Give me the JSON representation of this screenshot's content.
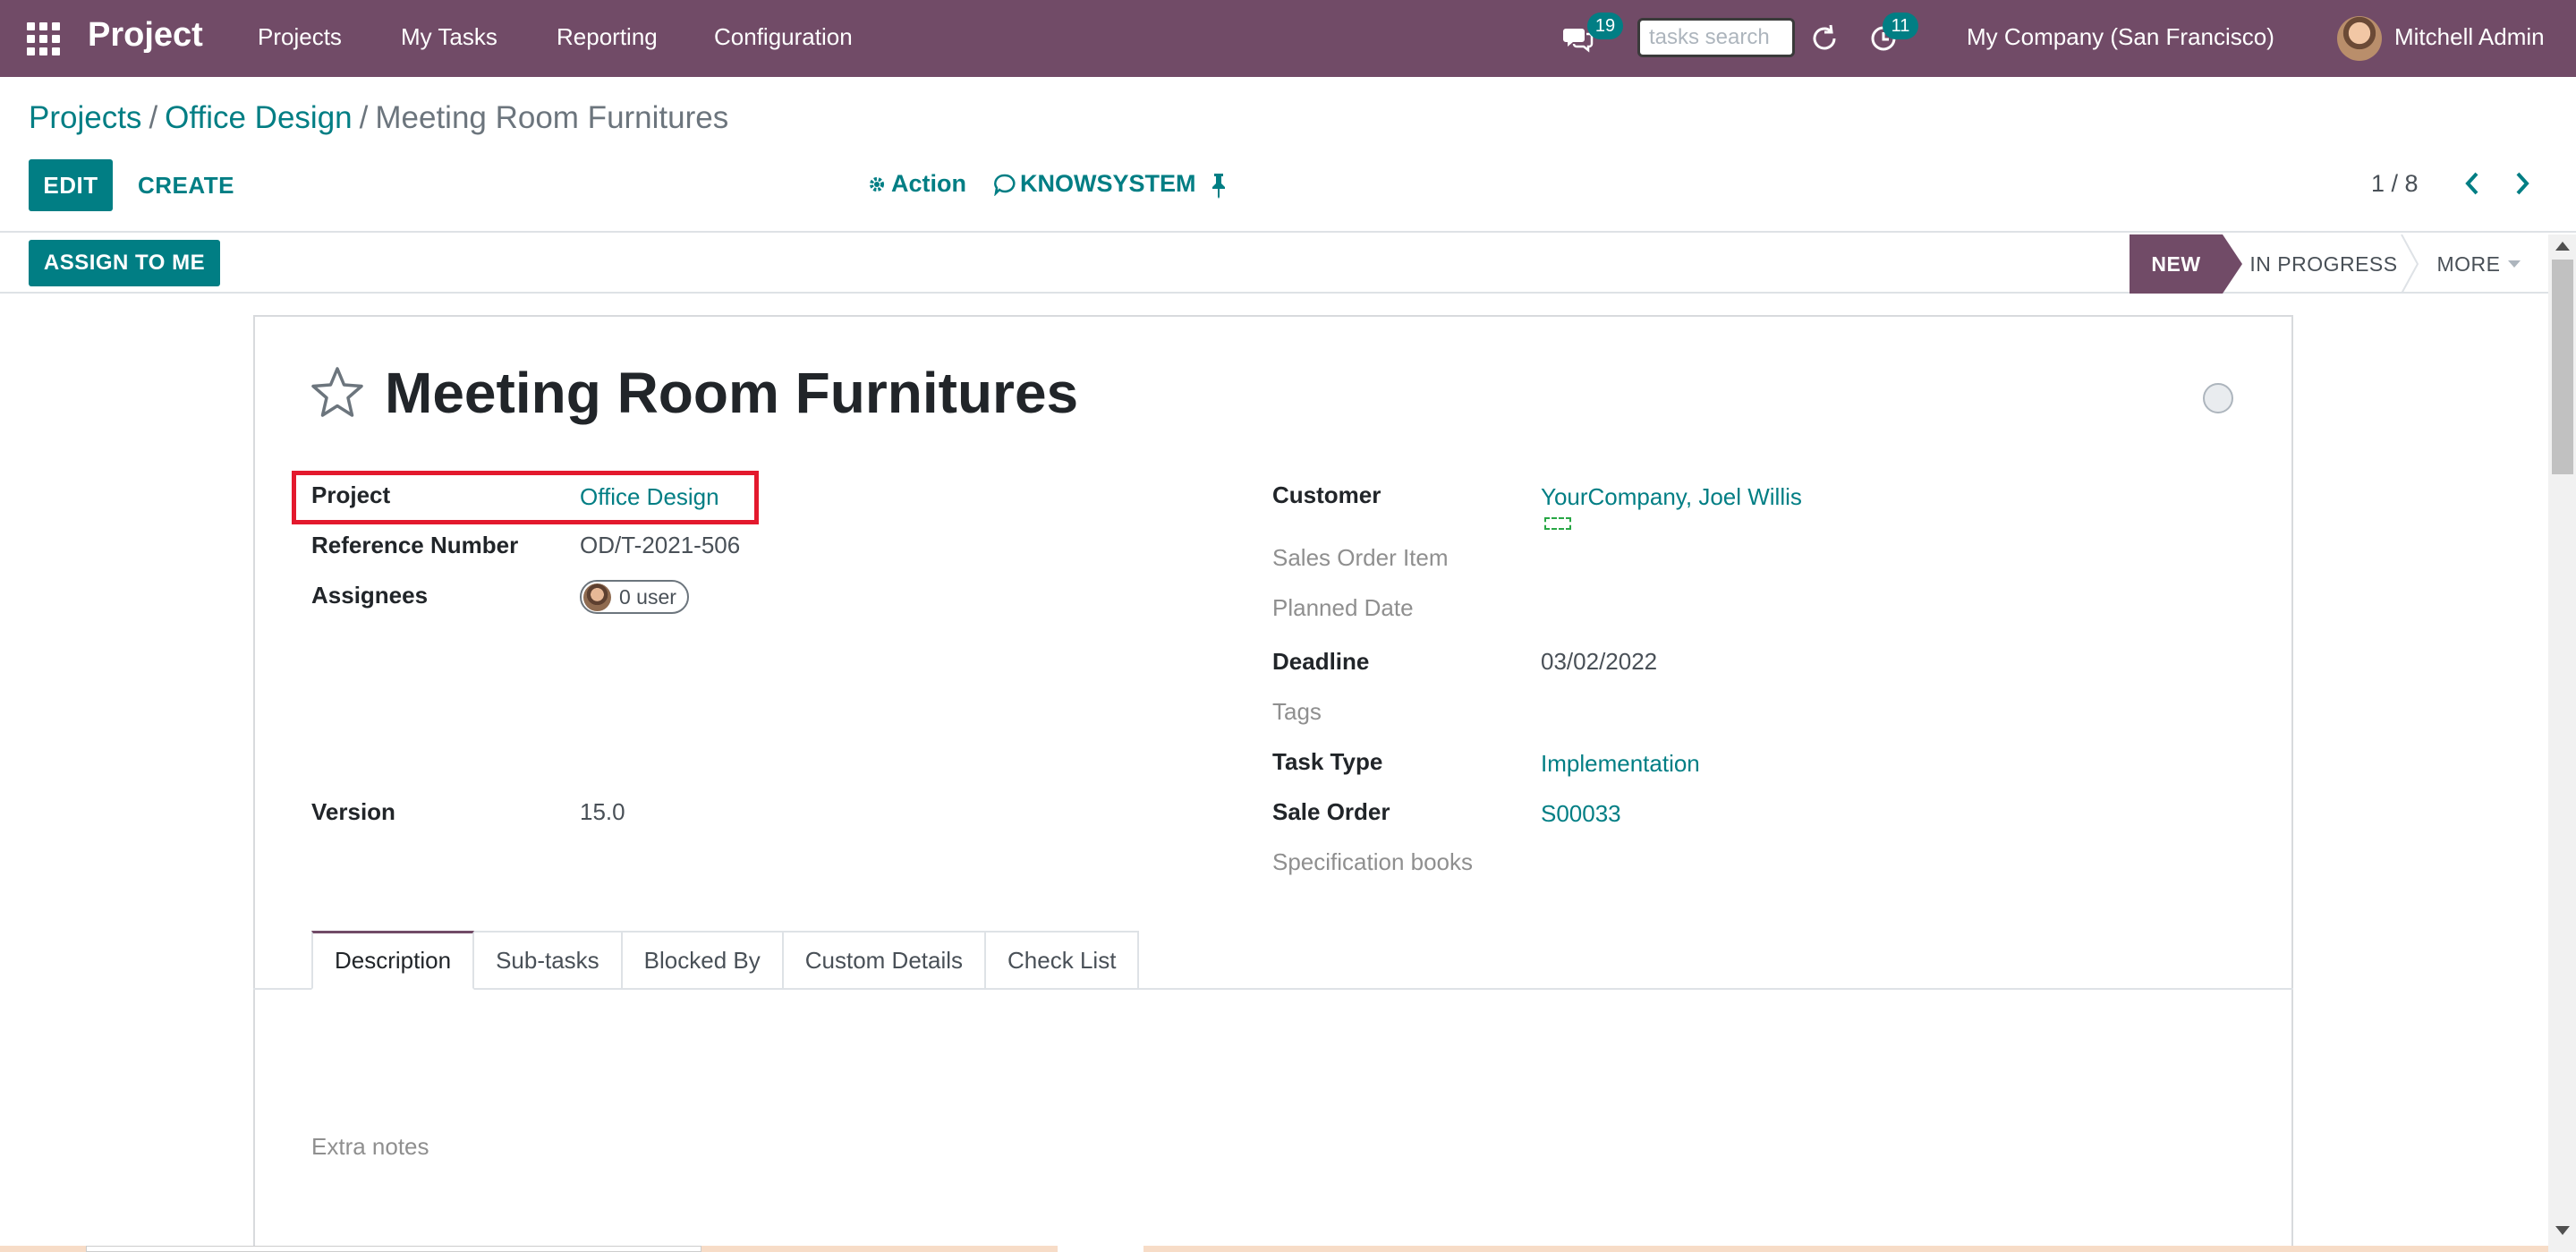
{
  "navbar": {
    "app_title": "Project",
    "menus": [
      "Projects",
      "My Tasks",
      "Reporting",
      "Configuration"
    ],
    "messages_count": "19",
    "search_placeholder": "tasks search",
    "activities_count": "11",
    "company": "My Company (San Francisco)",
    "user": "Mitchell Admin"
  },
  "breadcrumb": {
    "root": "Projects",
    "parent": "Office Design",
    "current": "Meeting Room Furnitures",
    "separator": "/"
  },
  "control_panel": {
    "edit_label": "EDIT",
    "create_label": "CREATE",
    "action_label": "Action",
    "knowsystem_label": "KNOWSYSTEM",
    "pager": "1 / 8"
  },
  "statusbar": {
    "assign_label": "ASSIGN TO ME",
    "stages": [
      "NEW",
      "IN PROGRESS",
      "MORE"
    ],
    "active_stage": "NEW"
  },
  "task": {
    "title": "Meeting Room Furnitures",
    "left_fields": [
      {
        "label": "Project",
        "value": "Office Design"
      },
      {
        "label": "Reference Number",
        "value": "OD/T-2021-506"
      },
      {
        "label": "Assignees",
        "value": "0 user"
      },
      {
        "label": "Version",
        "value": "15.0"
      }
    ],
    "right_fields": [
      {
        "label": "Customer",
        "value": "YourCompany, Joel Willis"
      },
      {
        "label": "Sales Order Item",
        "value": ""
      },
      {
        "label": "Planned Date",
        "value": ""
      },
      {
        "label": "Deadline",
        "value": "03/02/2022"
      },
      {
        "label": "Tags",
        "value": ""
      },
      {
        "label": "Task Type",
        "value": "Implementation"
      },
      {
        "label": "Sale Order",
        "value": "S00033"
      },
      {
        "label": "Specification books",
        "value": ""
      }
    ]
  },
  "tabs": [
    "Description",
    "Sub-tasks",
    "Blocked By",
    "Custom Details",
    "Check List"
  ],
  "description": {
    "placeholder": "Extra notes"
  },
  "colors": {
    "brand": "#714b67",
    "accent": "#017e84",
    "highlight": "#e3192d"
  }
}
